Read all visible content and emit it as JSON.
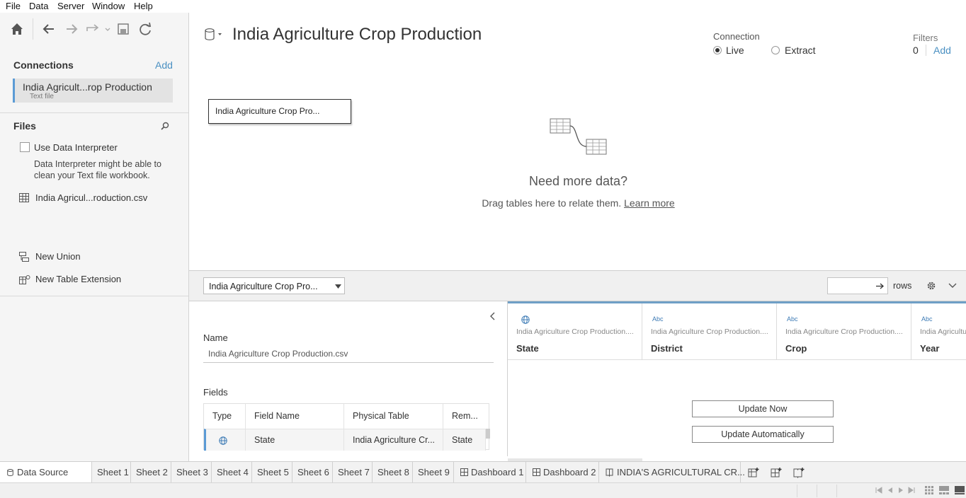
{
  "menu": [
    "File",
    "Data",
    "Server",
    "Window",
    "Help"
  ],
  "sidebar": {
    "connections_title": "Connections",
    "add_label": "Add",
    "connection": {
      "name": "India Agricult...rop Production",
      "type": "Text file"
    },
    "files_title": "Files",
    "use_interpreter": "Use Data Interpreter",
    "interpreter_note_1": "Data Interpreter might be able to",
    "interpreter_note_2": "clean your Text file workbook.",
    "file_name": "India Agricul...roduction.csv",
    "new_union": "New Union",
    "new_table_extension": "New Table Extension"
  },
  "main": {
    "title": "India Agriculture Crop Production",
    "connection_label": "Connection",
    "live_label": "Live",
    "extract_label": "Extract",
    "filters_label": "Filters",
    "filters_count": "0",
    "filters_add": "Add",
    "table_box": "India Agriculture Crop Pro...",
    "need_more": "Need more data?",
    "drag_text": "Drag tables here to relate them.",
    "learn_more": "Learn more"
  },
  "toolbar": {
    "table_select": "India Agriculture Crop Pro...",
    "rows_label": "rows"
  },
  "meta": {
    "name_label": "Name",
    "name_value": "India Agriculture Crop Production.csv",
    "fields_label": "Fields",
    "headers": [
      "Type",
      "Field Name",
      "Physical Table",
      "Rem..."
    ],
    "row": {
      "field_name": "State",
      "physical_table": "India Agriculture Cr...",
      "remote": "State"
    }
  },
  "grid": {
    "columns": [
      {
        "type": "globe-icon",
        "source": "India Agriculture Crop Production....",
        "name": "State"
      },
      {
        "type": "Abc",
        "source": "India Agriculture Crop Production....",
        "name": "District"
      },
      {
        "type": "Abc",
        "source": "India Agriculture Crop Production....",
        "name": "Crop"
      },
      {
        "type": "Abc",
        "source": "India Agricultu",
        "name": "Year"
      }
    ],
    "update_now": "Update Now",
    "update_auto": "Update Automatically"
  },
  "tabs": {
    "data_source": "Data Source",
    "sheets": [
      "Sheet 1",
      "Sheet 2",
      "Sheet 3",
      "Sheet 4",
      "Sheet 5",
      "Sheet 6",
      "Sheet 7",
      "Sheet 8",
      "Sheet 9"
    ],
    "dashboards": [
      "Dashboard 1",
      "Dashboard 2"
    ],
    "story": "INDIA'S AGRICULTURAL CR..."
  },
  "colors": {
    "accent": "#4a90c2",
    "grid_top": "#6f9fc6",
    "sidebar_bg": "#f5f5f5"
  }
}
